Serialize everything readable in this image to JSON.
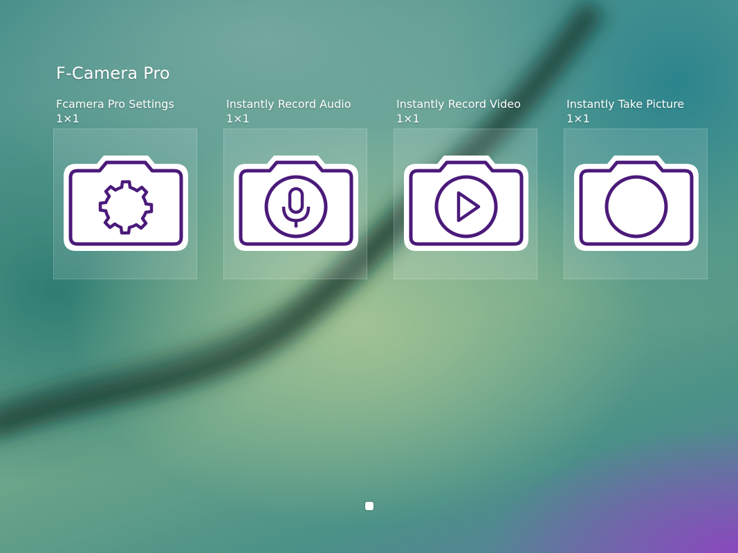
{
  "app_title": "F-Camera Pro",
  "widgets": [
    {
      "label": "Fcamera Pro Settings",
      "size": "1×1",
      "icon": "camera-settings-icon"
    },
    {
      "label": "Instantly Record Audio",
      "size": "1×1",
      "icon": "camera-microphone-icon"
    },
    {
      "label": "Instantly Record Video",
      "size": "1×1",
      "icon": "camera-play-icon"
    },
    {
      "label": "Instantly Take Picture",
      "size": "1×1",
      "icon": "camera-shutter-icon"
    }
  ],
  "colors": {
    "icon_stroke": "#4b1a7a",
    "icon_fill": "#ffffff"
  },
  "pagination": {
    "pages": 1,
    "current": 1
  }
}
